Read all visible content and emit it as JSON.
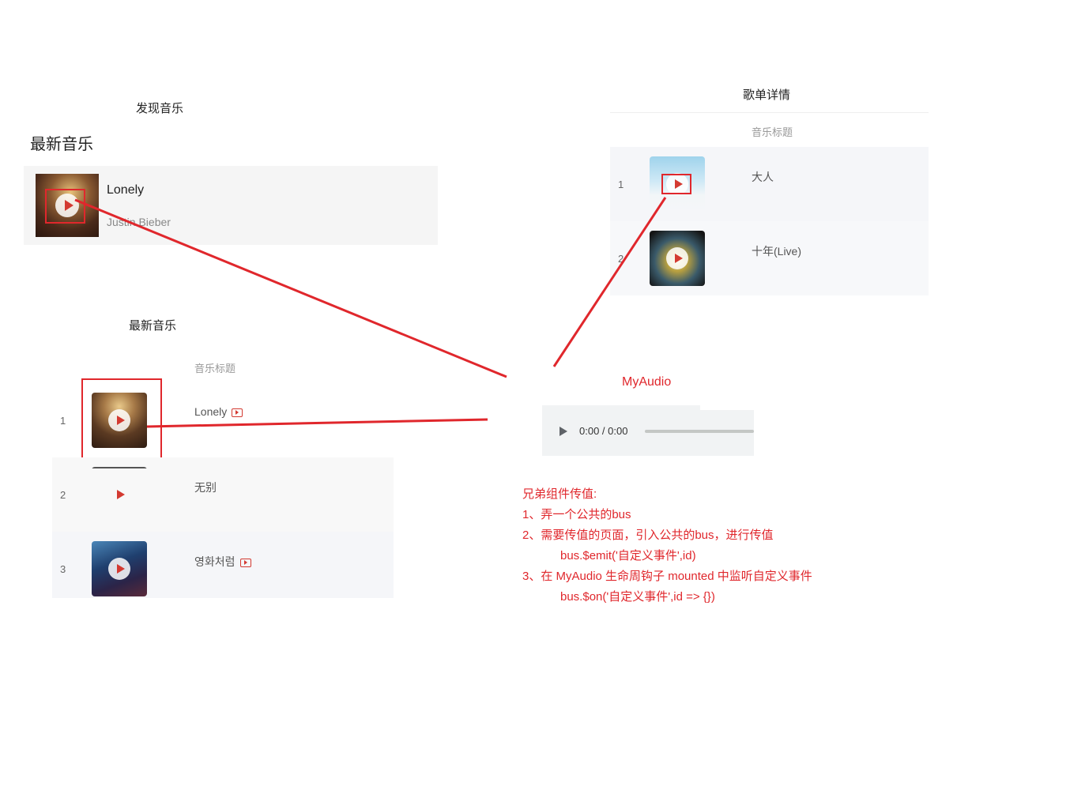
{
  "discover": {
    "page_title": "发现音乐",
    "section_title": "最新音乐",
    "song": {
      "title": "Lonely",
      "artist": "Justin Bieber"
    }
  },
  "newmusic": {
    "page_title": "最新音乐",
    "column_header": "音乐标题",
    "rows": [
      {
        "index": "1",
        "title": "Lonely",
        "has_mv": true
      },
      {
        "index": "2",
        "title": "无别",
        "has_mv": false
      },
      {
        "index": "3",
        "title": "영화처럼",
        "has_mv": true
      }
    ]
  },
  "playlist": {
    "page_title": "歌单详情",
    "column_header": "音乐标题",
    "rows": [
      {
        "index": "1",
        "title": "大人"
      },
      {
        "index": "2",
        "title": "十年(Live)"
      }
    ]
  },
  "myaudio": {
    "label": "MyAudio",
    "time": "0:00 / 0:00",
    "progress": 0
  },
  "notes": {
    "heading": "兄弟组件传值:",
    "step1": "1、弄一个公共的bus",
    "step2": "2、需要传值的页面，引入公共的bus，进行传值",
    "step2_code": "bus.$emit('自定义事件',id)",
    "step3": "3、在 MyAudio 生命周钩子 mounted 中监听自定义事件",
    "step3_code": "bus.$on('自定义事件',id => {})"
  },
  "colors": {
    "accent": "#e0272c",
    "play": "#d33a31",
    "row_bg": "#f5f5f5",
    "row_alt": "#f7f8fa"
  },
  "icons": {
    "play": "play-icon",
    "mv": "mv-icon"
  }
}
